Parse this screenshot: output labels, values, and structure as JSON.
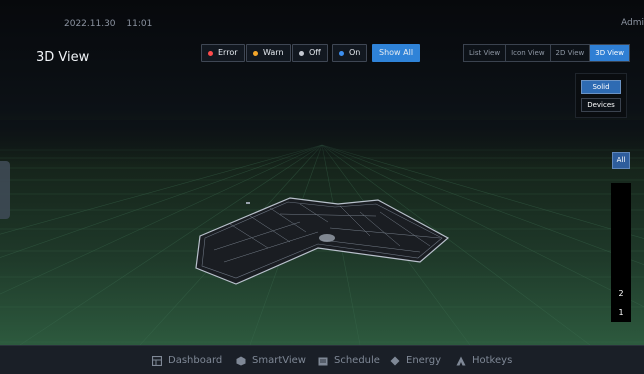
{
  "header": {
    "date": "2022.11.30",
    "time": "11:01",
    "user": "Admi",
    "page_title": "3D View"
  },
  "filters": [
    {
      "label": "Error",
      "color": "#ff4b4b"
    },
    {
      "label": "Warn",
      "color": "#f4a62a"
    },
    {
      "label": "Off",
      "color": "#c4c9d1"
    },
    {
      "label": "On",
      "color": "#3c8ff0"
    },
    {
      "label": "Show All",
      "active": true
    }
  ],
  "view_tabs": [
    {
      "label": "List View"
    },
    {
      "label": "Icon View"
    },
    {
      "label": "2D View"
    },
    {
      "label": "3D View",
      "active": true
    }
  ],
  "mode_panel": {
    "solid": "Solid",
    "devices": "Devices"
  },
  "floor_selector": {
    "all": "All",
    "floors": [
      "2",
      "1"
    ],
    "selected": "1"
  },
  "bottom_nav": [
    {
      "label": "Dashboard",
      "icon": "dashboard-icon"
    },
    {
      "label": "SmartView",
      "icon": "smartview-icon"
    },
    {
      "label": "Schedule",
      "icon": "schedule-icon"
    },
    {
      "label": "Energy",
      "icon": "energy-icon"
    },
    {
      "label": "Hotkeys",
      "icon": "hotkeys-icon"
    }
  ],
  "colors": {
    "accent": "#2f83d8",
    "ground": "#2d5a3e"
  }
}
